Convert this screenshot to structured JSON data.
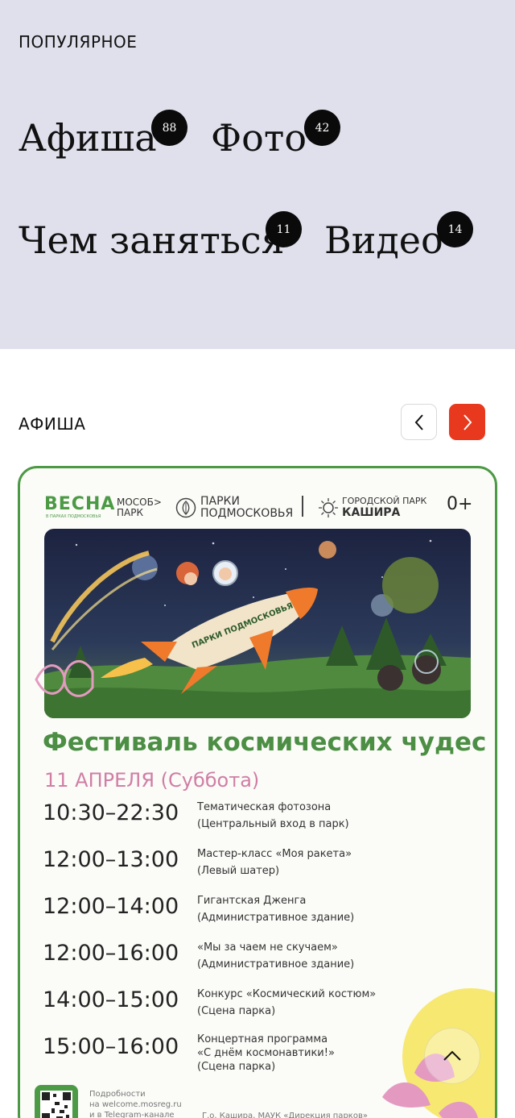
{
  "popular": {
    "label": "ПОПУЛЯРНОЕ",
    "links": [
      {
        "label": "Афиша",
        "count": "88"
      },
      {
        "label": "Фото",
        "count": "42"
      },
      {
        "label": "Чем заняться",
        "count": "11"
      },
      {
        "label": "Видео",
        "count": "14"
      }
    ]
  },
  "afisha": {
    "label": "АФИША",
    "accent_color": "#e8391e",
    "poster": {
      "logos": {
        "vesna": "ВЕСНА",
        "vesna_sub": "В ПАРКАХ ПОДМОСКОВЬЯ",
        "mosobl": "МОСОБ> ПАРК",
        "parki": "ПАРКИ ПОДМОСКОВЬЯ",
        "kashira_top": "ГОРОДСКОЙ ПАРК",
        "kashira_name": "КАШИРА",
        "age": "0+"
      },
      "rocket_label": "ПАРКИ ПОДМОСКОВЬЯ",
      "title": "Фестиваль космических чудес",
      "date": "11 АПРЕЛЯ (Суббота)",
      "schedule": [
        {
          "time": "10:30–22:30",
          "line1": "Тематическая фотозона",
          "line2": "(Центральный вход в парк)"
        },
        {
          "time": "12:00–13:00",
          "line1": "Мастер-класс «Моя ракета»",
          "line2": "(Левый шатер)"
        },
        {
          "time": "12:00–14:00",
          "line1": "Гигантская Дженга",
          "line2": "(Административное здание)"
        },
        {
          "time": "12:00–16:00",
          "line1": "«Мы за чаем не скучаем»",
          "line2": "(Административное здание)"
        },
        {
          "time": "14:00–15:00",
          "line1": "Конкурс «Космический костюм»",
          "line2": "(Сцена парка)"
        },
        {
          "time": "15:00–16:00",
          "line1": "Концертная программа",
          "line2": "«С днём космонавтики!»",
          "line3": "(Сцена парка)"
        }
      ],
      "footer_line1": "Подробности",
      "footer_line2": "на welcome.mosreg.ru",
      "footer_line3": "и в Telegram-канале",
      "footer_org": "Г.о. Кашира, МАУК «Дирекция парков»"
    }
  },
  "icons": {
    "prev": "chevron-left-icon",
    "next": "chevron-right-icon",
    "scroll_top": "chevron-up-icon"
  }
}
